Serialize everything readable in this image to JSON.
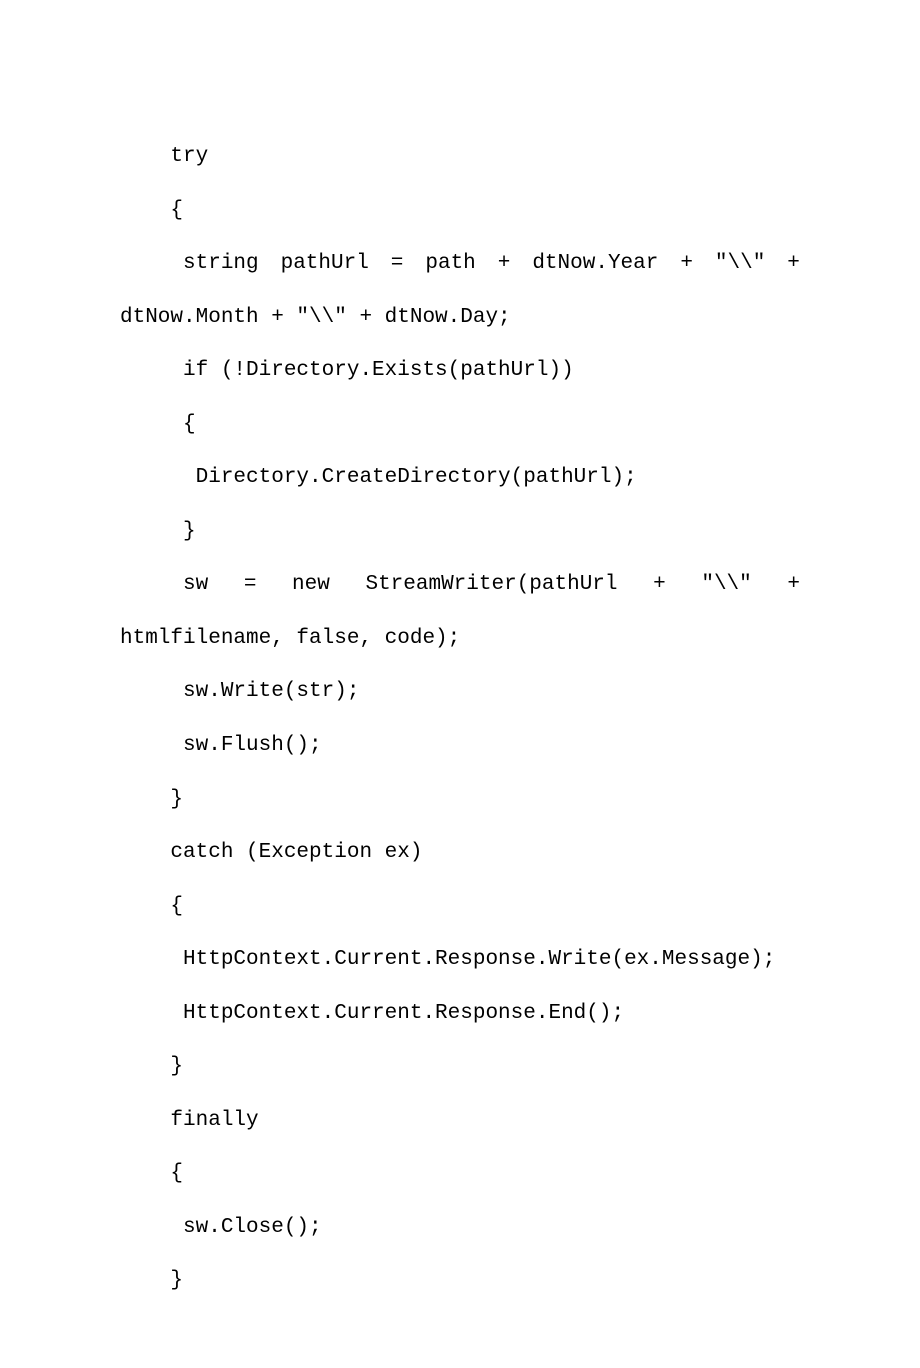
{
  "code": {
    "lines": [
      {
        "type": "pre",
        "text": "    try"
      },
      {
        "type": "pre",
        "text": "    {"
      },
      {
        "type": "justify",
        "words": [
          "     string",
          "pathUrl",
          "=",
          "path",
          "+",
          "dtNow.Year",
          "+",
          "\"\\\\\"",
          "+"
        ]
      },
      {
        "type": "pre",
        "text": "dtNow.Month + \"\\\\\" + dtNow.Day;"
      },
      {
        "type": "pre",
        "text": "     if (!Directory.Exists(pathUrl))"
      },
      {
        "type": "pre",
        "text": "     {"
      },
      {
        "type": "pre",
        "text": "      Directory.CreateDirectory(pathUrl);"
      },
      {
        "type": "pre",
        "text": "     }"
      },
      {
        "type": "justify",
        "words": [
          "     sw",
          "=",
          "new",
          "StreamWriter(pathUrl",
          "+",
          "\"\\\\\"",
          "+"
        ]
      },
      {
        "type": "pre",
        "text": "htmlfilename, false, code);"
      },
      {
        "type": "pre",
        "text": "     sw.Write(str);"
      },
      {
        "type": "pre",
        "text": "     sw.Flush();"
      },
      {
        "type": "pre",
        "text": "    }"
      },
      {
        "type": "pre",
        "text": "    catch (Exception ex)"
      },
      {
        "type": "pre",
        "text": "    {"
      },
      {
        "type": "pre",
        "text": "     HttpContext.Current.Response.Write(ex.Message);"
      },
      {
        "type": "pre",
        "text": "     HttpContext.Current.Response.End();"
      },
      {
        "type": "pre",
        "text": "    }"
      },
      {
        "type": "pre",
        "text": "    finally"
      },
      {
        "type": "pre",
        "text": "    {"
      },
      {
        "type": "pre",
        "text": "     sw.Close();"
      },
      {
        "type": "pre",
        "text": "    }"
      }
    ]
  }
}
